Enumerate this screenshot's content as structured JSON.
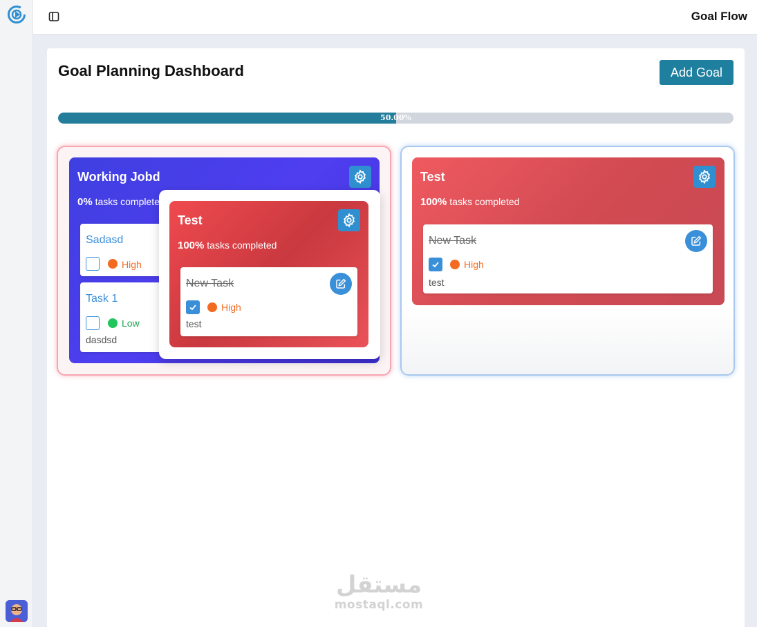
{
  "header": {
    "app_title": "Goal Flow"
  },
  "dashboard": {
    "title": "Goal Planning Dashboard",
    "add_goal_label": "Add Goal",
    "progress": {
      "value_percent": 50,
      "label": "50.00%"
    }
  },
  "goals": [
    {
      "title": "Working Jobd",
      "percent": "0%",
      "percent_suffix": " tasks completed",
      "tasks": [
        {
          "title": "Sadasd",
          "priority": "High",
          "completed": false,
          "description": ""
        },
        {
          "title": "Task 1",
          "priority": "Low",
          "completed": false,
          "description": "dasdsd"
        }
      ]
    },
    {
      "title": "Test",
      "percent": "100%",
      "percent_suffix": " tasks completed",
      "tasks": [
        {
          "title": "New Task",
          "priority": "High",
          "completed": true,
          "description": "test"
        }
      ]
    }
  ],
  "drag_preview": {
    "title": "Test",
    "percent": "100%",
    "percent_suffix": " tasks completed",
    "task": {
      "title": "New Task",
      "priority": "High",
      "completed": true,
      "description": "test"
    }
  },
  "colors": {
    "accent": "#1f7f9e",
    "priority_high": "#f26b21",
    "priority_low": "#22c55e",
    "goal_purple": "#4338ea",
    "goal_red": "#e2474d"
  },
  "icons": {
    "logo": "goal-target-icon",
    "sidebar_toggle": "sidebar-toggle-icon",
    "settings": "gear-icon",
    "edit": "edit-icon",
    "check": "check-icon"
  },
  "watermark": {
    "arabic": "مستقل",
    "latin": "mostaql.com"
  }
}
